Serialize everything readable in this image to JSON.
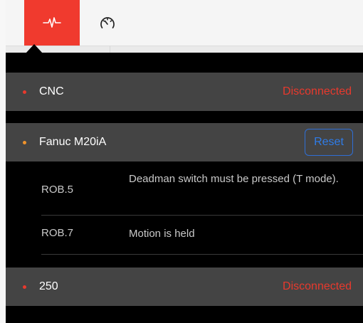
{
  "toolbar": {
    "tabs": [
      {
        "icon": "heartbeat-icon",
        "active": true
      },
      {
        "icon": "speedometer-icon",
        "active": false
      }
    ]
  },
  "colors": {
    "accent": "#f03a2e",
    "panel_bg": "#000000",
    "row_bg": "#444444",
    "status_red": "#e8392d",
    "warn_orange": "#f0932b",
    "reset_blue": "#2f7ce8"
  },
  "devices": [
    {
      "name": "CNC",
      "status": "Disconnected"
    },
    {
      "name": "Fanuc M20iA",
      "action_label": "Reset",
      "alarms": [
        {
          "code": "ROB.5",
          "message": "Deadman switch must be pressed (T mode)."
        },
        {
          "code": "ROB.7",
          "message": "Motion is held"
        }
      ]
    },
    {
      "name": "250",
      "status": "Disconnected"
    }
  ]
}
